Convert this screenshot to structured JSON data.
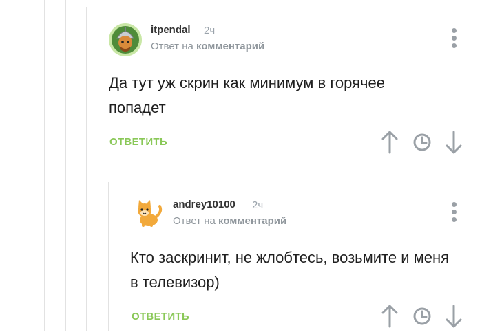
{
  "thread": [
    {
      "author": "itpendal",
      "time": "2ч",
      "reply_prefix": "Ответ на",
      "reply_target": "комментарий",
      "text": "Да тут уж скрин как минимум в горячее попадет",
      "reply_label": "ОТВЕТИТЬ",
      "avatar_icon": "knight-avatar-icon"
    },
    {
      "author": "andrey10100",
      "time": "2ч",
      "reply_prefix": "Ответ на",
      "reply_target": "комментарий",
      "text": "Кто заскринит, не жлобтесь, возьмите и меня в телевизор)",
      "reply_label": "ОТВЕТИТЬ",
      "avatar_icon": "cat-avatar-icon"
    }
  ],
  "colors": {
    "accent": "#8ac858",
    "muted": "#9aa0a6",
    "text": "#1f1f1f",
    "thread_line": "#e2e2e2"
  }
}
